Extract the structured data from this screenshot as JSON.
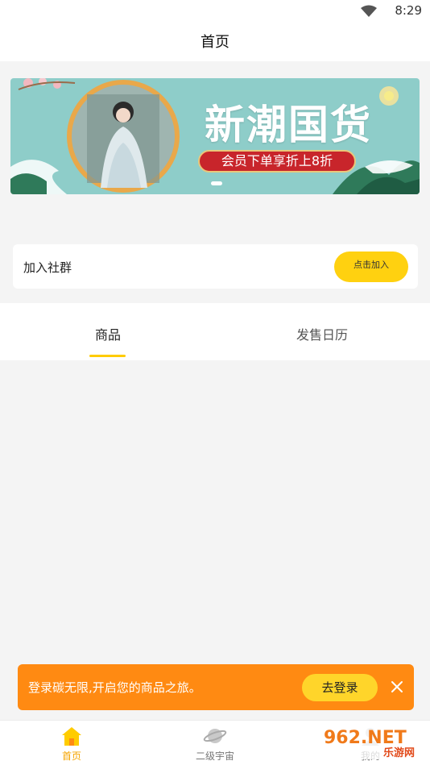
{
  "status_bar": {
    "time": "8:29",
    "icons": [
      "wifi-icon"
    ]
  },
  "header": {
    "title": "首页"
  },
  "banner": {
    "title": "新潮国货",
    "promo": "会员下单享折上8折",
    "colors": {
      "background": "#8ecdc9",
      "promo": "#c8252b",
      "frame": "#e9a84a"
    }
  },
  "community": {
    "label": "加入社群",
    "button": "点击加入"
  },
  "tabs": [
    {
      "label": "商品",
      "active": true
    },
    {
      "label": "发售日历",
      "active": false
    }
  ],
  "login_toast": {
    "text": "登录碳无限,开启您的商品之旅。",
    "button": "去登录",
    "close_icon": "close-icon"
  },
  "bottom_nav": [
    {
      "label": "首页",
      "icon": "home-icon",
      "active": true
    },
    {
      "label": "二级宇宙",
      "icon": "planet-icon",
      "active": false
    },
    {
      "label": "我的",
      "icon": "user-icon",
      "active": false
    }
  ],
  "watermark": {
    "brand": "962.NET",
    "subtitle": "乐游网"
  },
  "accent_colors": {
    "primary": "#ffcc00",
    "toast": "#ff8a12",
    "active_tab_text": "#f5a400"
  }
}
